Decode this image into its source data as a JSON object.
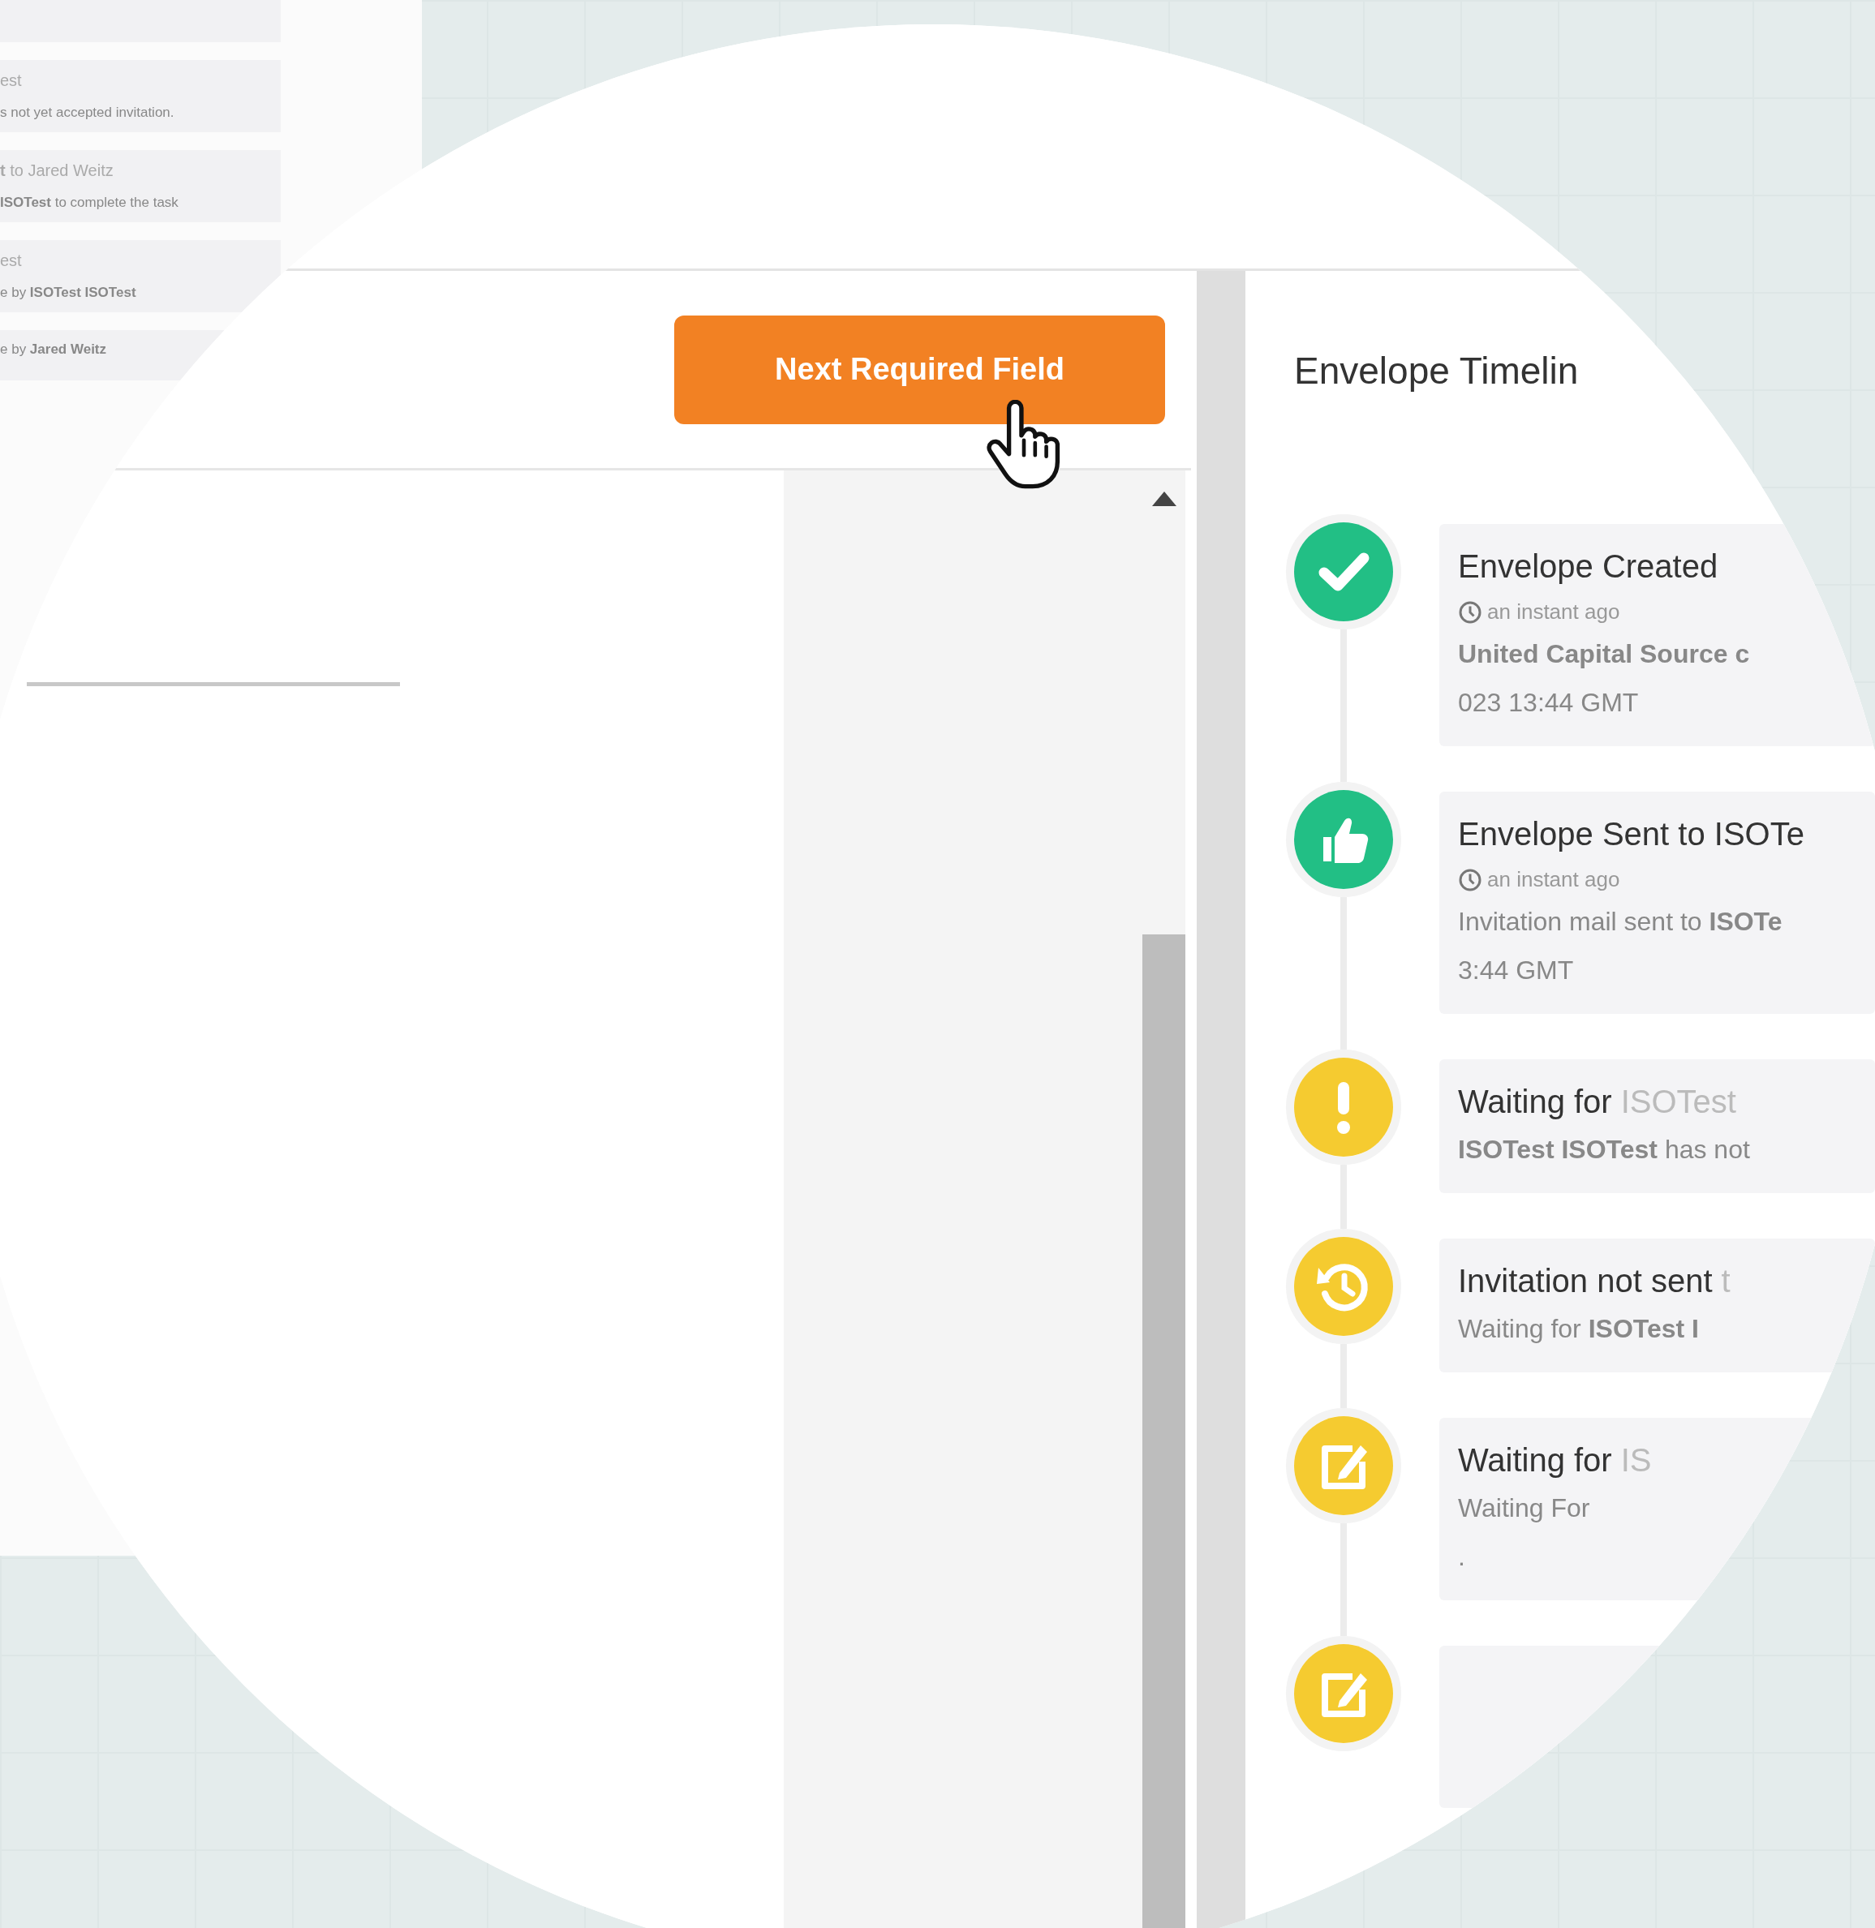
{
  "side_panel": {
    "cards": [
      {
        "title": "est",
        "text": "s not yet accepted invitation."
      },
      {
        "title": "**t** to Jared Weitz",
        "text": "**ISOTest** to complete the task"
      },
      {
        "title": "est",
        "text": "e by **ISOTest ISOTest**"
      },
      {
        "text": "e by **Jared Weitz**"
      }
    ]
  },
  "toolbar": {
    "button": "Next Required Field"
  },
  "timeline": {
    "title": "Envelope Timelin",
    "items": [
      {
        "kind": "check",
        "color": "#22bf85",
        "title": "Envelope Created",
        "time": "an instant ago",
        "lines": [
          "**United Capital Source c**",
          "023 13:44 GMT"
        ]
      },
      {
        "kind": "thumb",
        "color": "#22bf85",
        "title": "Envelope Sent to ISOTe",
        "time": "an instant ago",
        "lines": [
          "Invitation mail sent to **ISOTe**",
          "3:44 GMT"
        ]
      },
      {
        "kind": "alert",
        "color": "#f5cb30",
        "title": "Waiting for",
        "note": "ISOTest",
        "lines": [
          "**ISOTest ISOTest** has not"
        ]
      },
      {
        "kind": "history",
        "color": "#f5cb30",
        "title": "Invitation not sent",
        "note": "t",
        "lines": [
          "Waiting for **ISOTest I**"
        ]
      },
      {
        "kind": "edit",
        "color": "#f5cb30",
        "title": "Waiting for",
        "note": "IS",
        "lines": [
          "Waiting For",
          "."
        ]
      },
      {
        "kind": "edit",
        "color": "#f5cb30"
      }
    ]
  }
}
